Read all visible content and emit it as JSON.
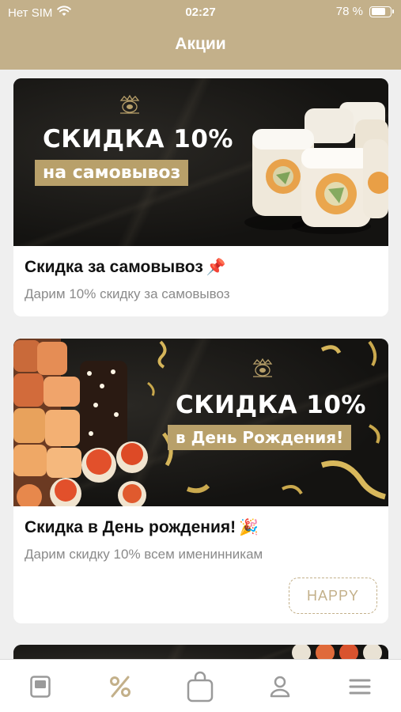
{
  "status_bar": {
    "carrier": "Нет SIM",
    "time": "02:27",
    "battery": "78 %",
    "battery_level": 0.78,
    "icons": [
      "wifi-icon",
      "battery-icon"
    ]
  },
  "header": {
    "title": "Акции"
  },
  "promos": [
    {
      "banner": {
        "heading": "СКИДКА 10%",
        "ribbon": "на самовывоз"
      },
      "title": "Скидка за самовывоз",
      "emoji": "📌",
      "subtitle": "Дарим 10% скидку за самовывоз"
    },
    {
      "banner": {
        "heading": "СКИДКА 10%",
        "ribbon": "в День Рождения!"
      },
      "title": "Скидка в День рождения!",
      "emoji": "🎉",
      "subtitle": "Дарим скидку 10% всем именинникам",
      "tag": "HAPPY"
    }
  ],
  "tabbar": {
    "items": [
      {
        "icon": "menu-book-icon",
        "active": false
      },
      {
        "icon": "percent-icon",
        "active": true
      },
      {
        "icon": "cart-bag-icon",
        "active": false
      },
      {
        "icon": "profile-icon",
        "active": false
      },
      {
        "icon": "hamburger-menu-icon",
        "active": false
      }
    ]
  },
  "colors": {
    "brand": "#c3b08a",
    "background": "#efefef",
    "card": "#ffffff",
    "banner_dark": "#151412",
    "ribbon": "#b8a06a",
    "icon_inactive": "#9a9a9a"
  }
}
